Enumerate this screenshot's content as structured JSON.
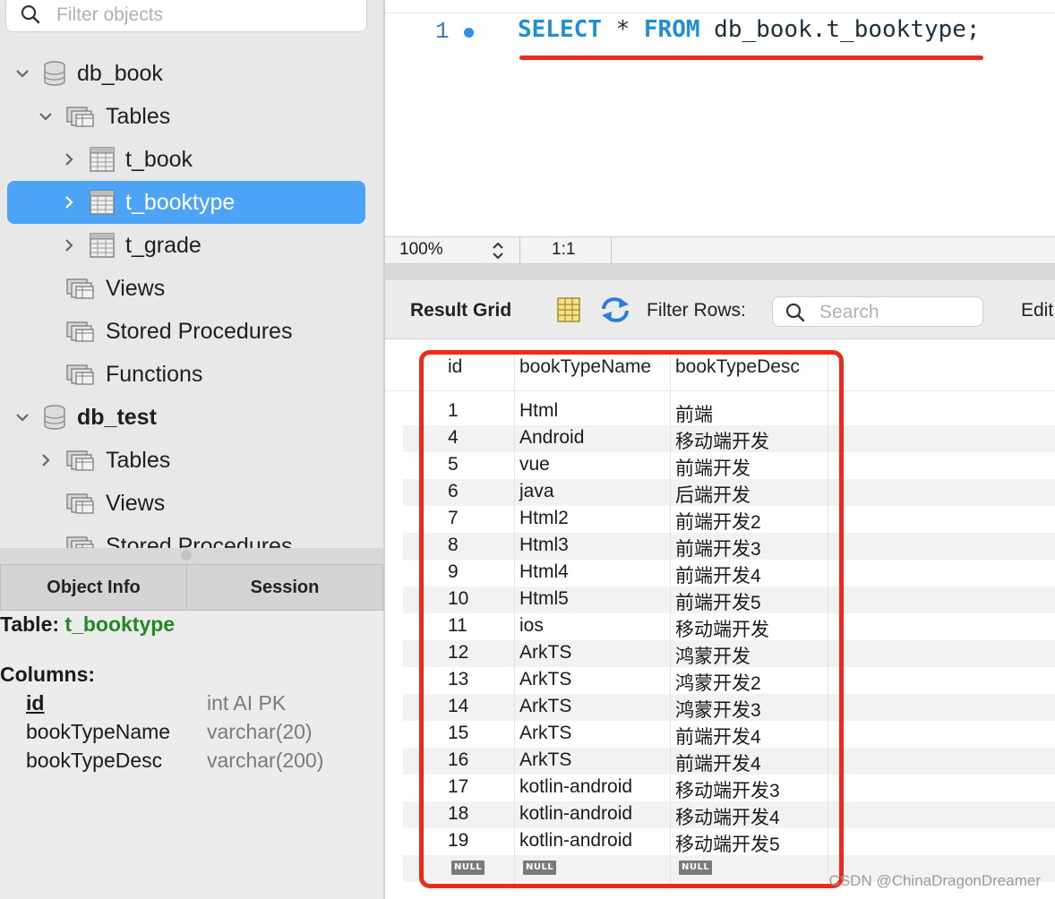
{
  "sidebar": {
    "filter_placeholder": "Filter objects",
    "tree": [
      {
        "label": "db_book",
        "kind": "schema",
        "level": 0,
        "chevron": "down",
        "bold": false
      },
      {
        "label": "Tables",
        "kind": "folder",
        "level": 1,
        "chevron": "down",
        "bold": false
      },
      {
        "label": "t_book",
        "kind": "table",
        "level": 2,
        "chevron": "right",
        "bold": false
      },
      {
        "label": "t_booktype",
        "kind": "table",
        "level": 2,
        "chevron": "right",
        "bold": false,
        "selected": true
      },
      {
        "label": "t_grade",
        "kind": "table",
        "level": 2,
        "chevron": "right",
        "bold": false
      },
      {
        "label": "Views",
        "kind": "folder",
        "level": 1,
        "chevron": "",
        "bold": false
      },
      {
        "label": "Stored Procedures",
        "kind": "folder",
        "level": 1,
        "chevron": "",
        "bold": false
      },
      {
        "label": "Functions",
        "kind": "folder",
        "level": 1,
        "chevron": "",
        "bold": false
      },
      {
        "label": "db_test",
        "kind": "schema",
        "level": 0,
        "chevron": "down",
        "bold": true
      },
      {
        "label": "Tables",
        "kind": "folder",
        "level": 1,
        "chevron": "right",
        "bold": false
      },
      {
        "label": "Views",
        "kind": "folder",
        "level": 1,
        "chevron": "",
        "bold": false
      },
      {
        "label": "Stored Procedures",
        "kind": "folder",
        "level": 1,
        "chevron": "",
        "bold": false
      }
    ],
    "info_tabs": [
      "Object Info",
      "Session"
    ],
    "info": {
      "table_label": "Table:",
      "table_name": "t_booktype",
      "columns_label": "Columns:",
      "columns": [
        {
          "name": "id",
          "type": "int AI PK"
        },
        {
          "name": "bookTypeName",
          "type": "varchar(20)"
        },
        {
          "name": "bookTypeDesc",
          "type": "varchar(200)"
        }
      ]
    }
  },
  "editor": {
    "line_number": "1",
    "code": {
      "kw1": "SELECT",
      "star": " * ",
      "kw2": "FROM",
      "rest": " db_book.t_booktype;"
    }
  },
  "status": {
    "zoom": "100%",
    "position": "1:1"
  },
  "result": {
    "title": "Result Grid",
    "filter_label": "Filter Rows:",
    "search_placeholder": "Search",
    "edit_label": "Edit",
    "columns": [
      "id",
      "bookTypeName",
      "bookTypeDesc"
    ],
    "rows": [
      [
        "1",
        "Html",
        "前端"
      ],
      [
        "4",
        "Android",
        "移动端开发"
      ],
      [
        "5",
        "vue",
        "前端开发"
      ],
      [
        "6",
        "java",
        "后端开发"
      ],
      [
        "7",
        "Html2",
        "前端开发2"
      ],
      [
        "8",
        "Html3",
        "前端开发3"
      ],
      [
        "9",
        "Html4",
        "前端开发4"
      ],
      [
        "10",
        "Html5",
        "前端开发5"
      ],
      [
        "11",
        "ios",
        "移动端开发"
      ],
      [
        "12",
        "ArkTS",
        "鸿蒙开发"
      ],
      [
        "13",
        "ArkTS",
        "鸿蒙开发2"
      ],
      [
        "14",
        "ArkTS",
        "鸿蒙开发3"
      ],
      [
        "15",
        "ArkTS",
        "前端开发4"
      ],
      [
        "16",
        "ArkTS",
        "前端开发4"
      ],
      [
        "17",
        "kotlin-android",
        "移动端开发3"
      ],
      [
        "18",
        "kotlin-android",
        "移动端开发4"
      ],
      [
        "19",
        "kotlin-android",
        "移动端开发5"
      ]
    ],
    "null_label": "NULL"
  },
  "watermark": "CSDN @ChinaDragonDreamer",
  "colors": {
    "selection": "#4da3f5",
    "keyword": "#1c8fd6",
    "annotation": "#ee2a1a",
    "table_name": "#1f8a1f"
  }
}
